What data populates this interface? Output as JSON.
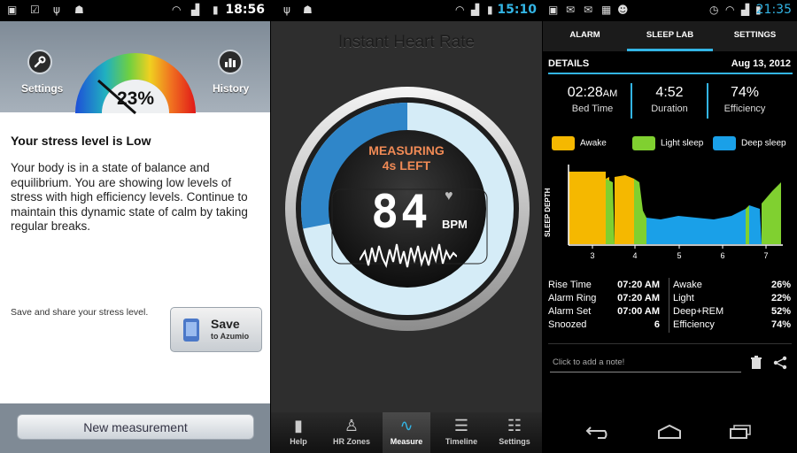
{
  "panel1": {
    "status": {
      "time": "18:56"
    },
    "settings_label": "Settings",
    "history_label": "History",
    "gauge_percent": "23%",
    "gauge_value": 0.23,
    "title": "Your stress level is Low",
    "body": "Your body is in a state of balance and equilibrium. You are showing low levels of stress with high efficiency levels. Continue to maintain this dynamic state of calm by taking regular breaks.",
    "save_hint": "Save and share your stress level.",
    "save_label": "Save",
    "save_sub": "to Azumio",
    "new_measurement": "New measurement",
    "icons": {
      "settings": "wrench-icon",
      "history": "bar-chart-icon"
    }
  },
  "panel2": {
    "status": {
      "time": "15:10"
    },
    "title": "Instant Heart Rate",
    "measuring": "MEASURING",
    "time_left": "4s LEFT",
    "bpm": "84",
    "bpm_unit": "BPM",
    "progress": 0.72,
    "tabs": [
      {
        "label": "Help",
        "icon": "book-icon"
      },
      {
        "label": "HR Zones",
        "icon": "walker-icon"
      },
      {
        "label": "Measure",
        "icon": "pulse-icon"
      },
      {
        "label": "Timeline",
        "icon": "list-icon"
      },
      {
        "label": "Settings",
        "icon": "sliders-icon"
      }
    ],
    "active_tab": "Measure"
  },
  "panel3": {
    "status": {
      "time": "21:35"
    },
    "tabs": [
      "ALARM",
      "SLEEP LAB",
      "SETTINGS"
    ],
    "active_tab": "SLEEP LAB",
    "details_label": "DETAILS",
    "date": "Aug 13, 2012",
    "bed_time": {
      "value": "02:28",
      "suffix": "AM",
      "label": "Bed Time"
    },
    "duration": {
      "value": "4:52",
      "label": "Duration"
    },
    "efficiency": {
      "value": "74%",
      "label": "Efficiency"
    },
    "legend": [
      {
        "name": "Awake",
        "color": "#f5b800"
      },
      {
        "name": "Light sleep",
        "color": "#80d030"
      },
      {
        "name": "Deep sleep",
        "color": "#1aa0e8"
      }
    ],
    "chart_ylabel": "SLEEP DEPTH",
    "chart_xticks": [
      "3",
      "4",
      "5",
      "6",
      "7"
    ],
    "rows_left": [
      {
        "label": "Rise Time",
        "value": "07:20 AM"
      },
      {
        "label": "Alarm Ring",
        "value": "07:20 AM"
      },
      {
        "label": "Alarm Set",
        "value": "07:00 AM"
      },
      {
        "label": "Snoozed",
        "value": "6"
      }
    ],
    "rows_right": [
      {
        "label": "Awake",
        "value": "26%"
      },
      {
        "label": "Light",
        "value": "22%"
      },
      {
        "label": "Deep+REM",
        "value": "52%"
      },
      {
        "label": "Efficiency",
        "value": "74%"
      }
    ],
    "note_placeholder": "Click to add a note!",
    "icons": {
      "delete": "trash-icon",
      "share": "share-icon"
    }
  }
}
